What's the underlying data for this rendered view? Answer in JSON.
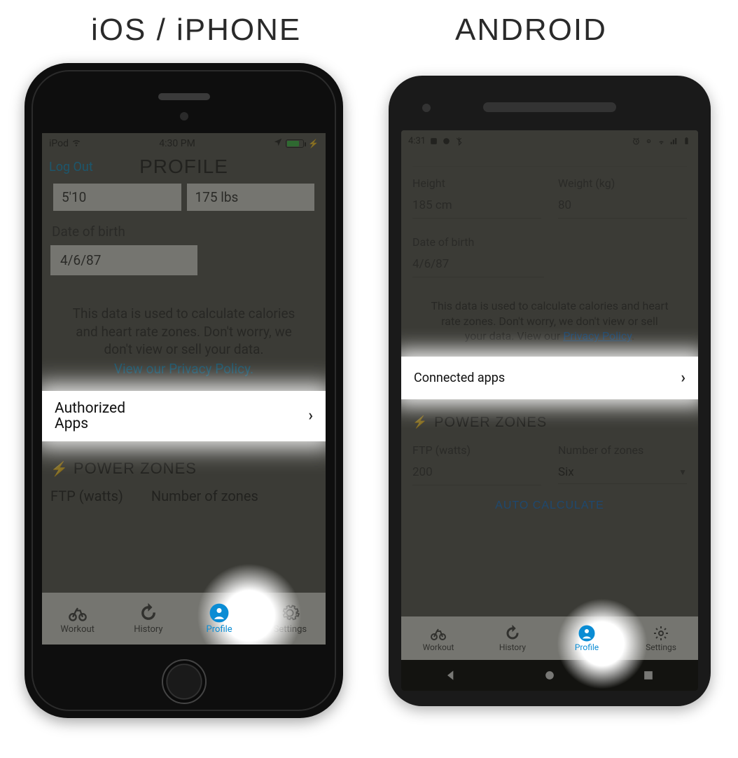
{
  "labels": {
    "ios": "iOS / iPHONE",
    "android": "ANDROID"
  },
  "ios": {
    "status": {
      "carrier": "iPod",
      "time": "4:30 PM"
    },
    "header": {
      "logout": "Log Out",
      "title": "PROFILE"
    },
    "height_value": "5'10",
    "weight_value": "175 lbs",
    "dob_label": "Date of birth",
    "dob_value": "4/6/87",
    "disclaimer_line1": "This data is used to calculate calories",
    "disclaimer_line2": "and heart rate zones. Don't worry, we",
    "disclaimer_line3": "don't view or sell your data.",
    "disclaimer_link": "View our Privacy Policy.",
    "authorized_label": "Authorized\nApps",
    "power_zones_heading": "POWER ZONES",
    "ftp_label": "FTP (watts)",
    "zones_label": "Number of zones",
    "tabs": {
      "workout": "Workout",
      "history": "History",
      "profile": "Profile",
      "settings": "Settings"
    }
  },
  "android": {
    "status": {
      "time": "4:31"
    },
    "height_label": "Height",
    "weight_label": "Weight (kg)",
    "height_value": "185 cm",
    "weight_value": "80",
    "dob_label": "Date of birth",
    "dob_value": "4/6/87",
    "disclaimer_line1": "This data is used to calculate calories and heart",
    "disclaimer_line2": "rate zones. Don't worry, we don't view or sell",
    "disclaimer_line3_pre": "your data. View our ",
    "disclaimer_link": "Privacy Policy",
    "connected_label": "Connected apps",
    "power_zones_heading": "POWER ZONES",
    "ftp_label": "FTP (watts)",
    "ftp_value": "200",
    "zones_label": "Number of zones",
    "zones_value": "Six",
    "auto_calc": "AUTO CALCULATE",
    "tabs": {
      "workout": "Workout",
      "history": "History",
      "profile": "Profile",
      "settings": "Settings"
    }
  }
}
